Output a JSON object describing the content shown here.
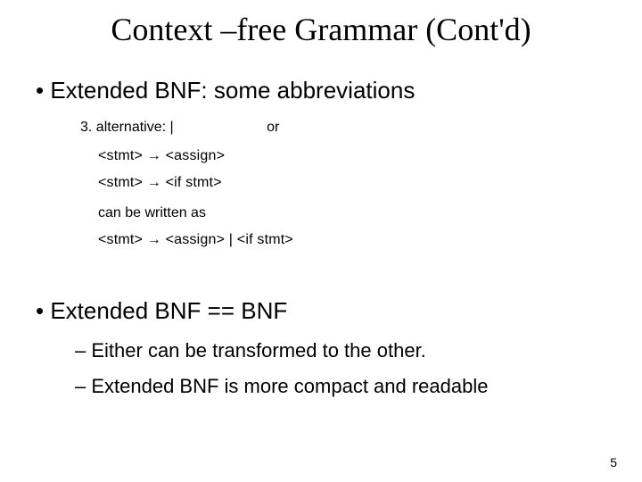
{
  "title": "Context –free Grammar (Cont'd)",
  "bullet_ebnf_abbrev": "Extended BNF: some abbreviations",
  "alt": {
    "num_label": "3.  alternative:  |",
    "or_word": "or",
    "rule1": "<stmt> → <assign>",
    "rule2": "<stmt> → <if stmt>",
    "can_be": "can be written as",
    "rule3": "<stmt> → <assign>  |  <if stmt>"
  },
  "bullet_equiv": "Extended BNF  == BNF",
  "dash_transform": "Either can be transformed to the other.",
  "dash_compact": "Extended BNF is more compact and readable",
  "page_number": "5"
}
